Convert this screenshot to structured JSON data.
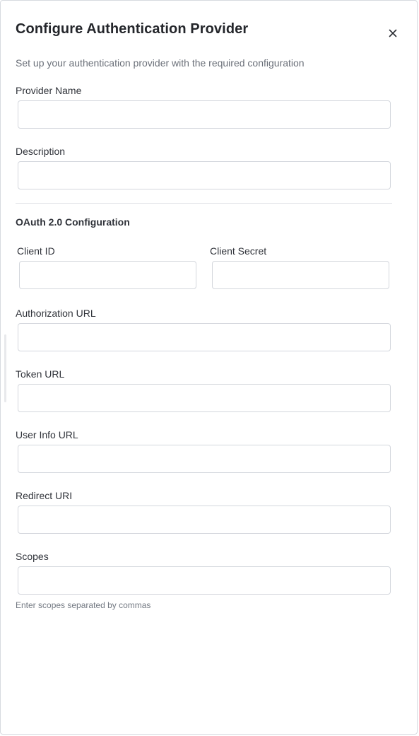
{
  "dialog": {
    "title": "Configure Authentication Provider",
    "subtitle": "Set up your authentication provider with the required configuration",
    "close_icon": "close-icon"
  },
  "fields": {
    "provider_name": {
      "label": "Provider Name",
      "value": ""
    },
    "description": {
      "label": "Description",
      "value": ""
    }
  },
  "oauth": {
    "section_title": "OAuth 2.0 Configuration",
    "client_id": {
      "label": "Client ID",
      "value": ""
    },
    "client_secret": {
      "label": "Client Secret",
      "value": ""
    },
    "authorization_url": {
      "label": "Authorization URL",
      "value": ""
    },
    "token_url": {
      "label": "Token URL",
      "value": ""
    },
    "user_info_url": {
      "label": "User Info URL",
      "value": ""
    },
    "redirect_uri": {
      "label": "Redirect URI",
      "value": ""
    },
    "scopes": {
      "label": "Scopes",
      "value": "",
      "hint": "Enter scopes separated by commas"
    }
  }
}
